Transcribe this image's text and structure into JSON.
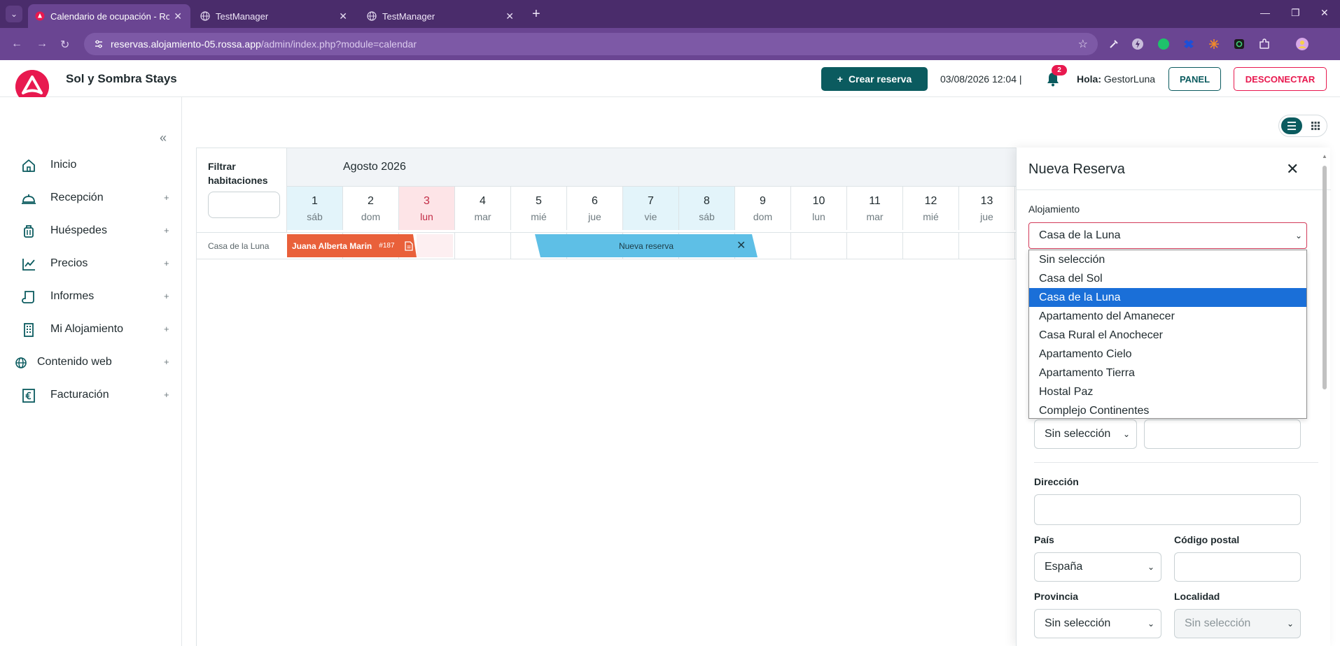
{
  "browser": {
    "tabs": [
      {
        "title": "Calendario de ocupación - Ross",
        "active": true
      },
      {
        "title": "TestManager",
        "active": false
      },
      {
        "title": "TestManager",
        "active": false
      }
    ],
    "url_host": "reservas.alojamiento-05.rossa.app",
    "url_path": "/admin/index.php?module=calendar"
  },
  "header": {
    "brand": "Sol y Sombra Stays",
    "create_label": "Crear reserva",
    "datetime": "03/08/2026 12:04 |",
    "notif_count": "2",
    "greeting": "Hola:",
    "username": "GestorLuna",
    "panel_label": "PANEL",
    "logout_label": "DESCONECTAR"
  },
  "sidebar": {
    "items": [
      {
        "label": "Inicio",
        "icon": "home-icon",
        "expandable": false
      },
      {
        "label": "Recepción",
        "icon": "bell-desk-icon",
        "expandable": true
      },
      {
        "label": "Huéspedes",
        "icon": "luggage-icon",
        "expandable": true
      },
      {
        "label": "Precios",
        "icon": "chart-line-icon",
        "expandable": true
      },
      {
        "label": "Informes",
        "icon": "scroll-icon",
        "expandable": true
      },
      {
        "label": "Mi Alojamiento",
        "icon": "building-icon",
        "expandable": true
      },
      {
        "label": "Contenido web",
        "icon": "globe-icon",
        "expandable": true
      },
      {
        "label": "Facturación",
        "icon": "euro-receipt-icon",
        "expandable": true
      }
    ],
    "plus": "+"
  },
  "calendar": {
    "filter_label": "Filtrar habitaciones",
    "month": "Agosto 2026",
    "days": [
      {
        "num": "1",
        "name": "sáb",
        "kind": "weekend"
      },
      {
        "num": "2",
        "name": "dom",
        "kind": "normal"
      },
      {
        "num": "3",
        "name": "lun",
        "kind": "today"
      },
      {
        "num": "4",
        "name": "mar",
        "kind": "normal"
      },
      {
        "num": "5",
        "name": "mié",
        "kind": "normal"
      },
      {
        "num": "6",
        "name": "jue",
        "kind": "normal"
      },
      {
        "num": "7",
        "name": "vie",
        "kind": "weekend"
      },
      {
        "num": "8",
        "name": "sáb",
        "kind": "weekend"
      },
      {
        "num": "9",
        "name": "dom",
        "kind": "normal"
      },
      {
        "num": "10",
        "name": "lun",
        "kind": "normal"
      },
      {
        "num": "11",
        "name": "mar",
        "kind": "normal"
      },
      {
        "num": "12",
        "name": "mié",
        "kind": "normal"
      },
      {
        "num": "13",
        "name": "jue",
        "kind": "normal"
      }
    ],
    "room": "Casa de la Luna",
    "booking": {
      "guest": "Juana Alberta Marin",
      "id": "#187"
    },
    "new_booking": "Nueva reserva"
  },
  "drawer": {
    "title": "Nueva Reserva",
    "alojamiento_label": "Alojamiento",
    "alojamiento_value": "Casa de la Luna",
    "options": [
      "Sin selección",
      "Casa del Sol",
      "Casa de la Luna",
      "Apartamento del Amanecer",
      "Casa Rural el Anochecer",
      "Apartamento Cielo",
      "Apartamento Tierra",
      "Hostal Paz",
      "Complejo Continentes"
    ],
    "selected_index": 2,
    "doc_type_value": "Sin selección",
    "direccion_label": "Dirección",
    "pais_label": "País",
    "pais_value": "España",
    "cp_label": "Código postal",
    "provincia_label": "Provincia",
    "provincia_value": "Sin selección",
    "localidad_label": "Localidad",
    "localidad_value": "Sin selección"
  },
  "colors": {
    "brand_primary": "#0b5b5f",
    "brand_accent": "#e8194f",
    "booking_orange": "#e9603a",
    "new_booking_blue": "#5ebfe6",
    "dropdown_highlight": "#1a6fd8"
  }
}
